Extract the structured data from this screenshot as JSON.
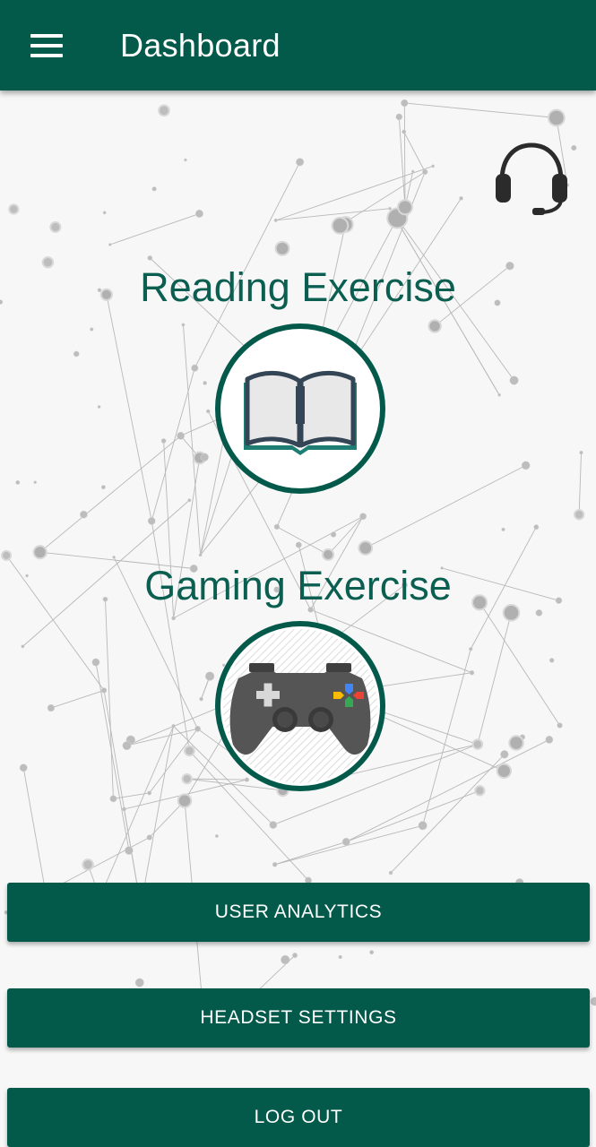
{
  "app_bar": {
    "title": "Dashboard",
    "background_color": "#03594a",
    "menu_icon": "hamburger-menu-icon"
  },
  "support_icon": "headset-icon",
  "exercises": {
    "reading": {
      "label": "Reading Exercise",
      "icon": "open-book-icon"
    },
    "gaming": {
      "label": "Gaming Exercise",
      "icon": "gamepad-icon"
    }
  },
  "buttons": {
    "user_analytics": "USER ANALYTICS",
    "headset_settings": "HEADSET SETTINGS",
    "log_out": "LOG OUT"
  },
  "colors": {
    "primary": "#03594a",
    "title_text": "#0b5f51",
    "background": "#f7f7f7"
  }
}
